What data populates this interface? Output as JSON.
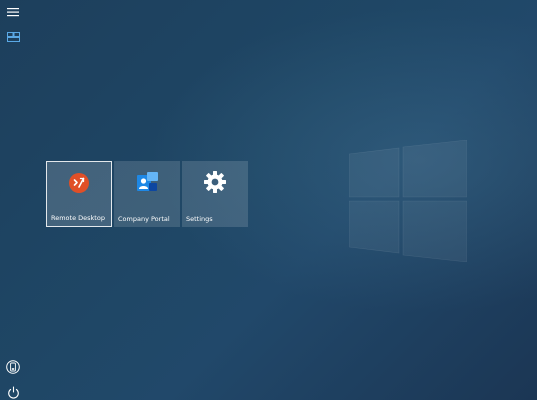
{
  "rail": {
    "menu_icon": "hamburger-menu-icon",
    "tiles_icon": "all-apps-icon",
    "user_icon": "user-account-icon",
    "power_icon": "power-icon"
  },
  "tiles": [
    {
      "label": "Remote Desktop",
      "icon": "remote-desktop-icon",
      "selected": true,
      "accent": "#e04f27"
    },
    {
      "label": "Company Portal",
      "icon": "company-portal-icon",
      "selected": false,
      "accent": "#1e88e5"
    },
    {
      "label": "Settings",
      "icon": "gear-icon",
      "selected": false,
      "accent": "#ffffff"
    }
  ],
  "colors": {
    "background": "#1f4766",
    "rail_accent": "#5aa9e6"
  }
}
